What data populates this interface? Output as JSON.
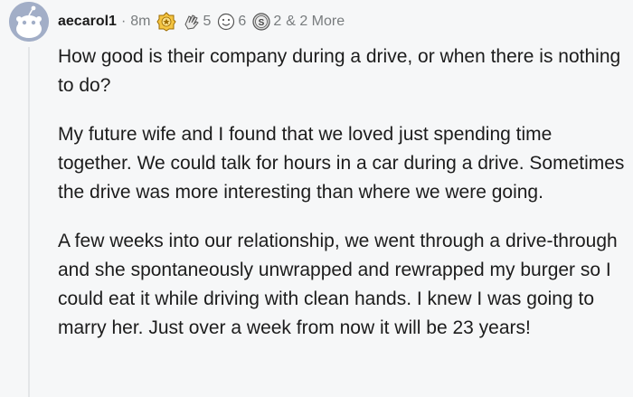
{
  "comment": {
    "username": "aecarol1",
    "separator": "·",
    "timestamp": "8m",
    "awards": [
      {
        "icon": "gold-award-icon",
        "count": ""
      },
      {
        "icon": "hands-award-icon",
        "count": "5"
      },
      {
        "icon": "smile-award-icon",
        "count": "6"
      },
      {
        "icon": "silver-award-icon",
        "count": "2"
      }
    ],
    "more_awards": "& 2 More",
    "paragraphs": [
      "How good is their company during a drive, or when there is nothing to do?",
      "My future wife and I found that we loved just spending time together. We could talk for hours in a car during a drive. Sometimes the drive was more interesting than where we were going.",
      "A few weeks into our relationship, we went through a drive-through and she spontaneously unwrapped and rewrapped my burger so I could eat it while driving with clean hands. I knew I was going to marry her. Just over a week from now it will be 23 years!"
    ]
  }
}
